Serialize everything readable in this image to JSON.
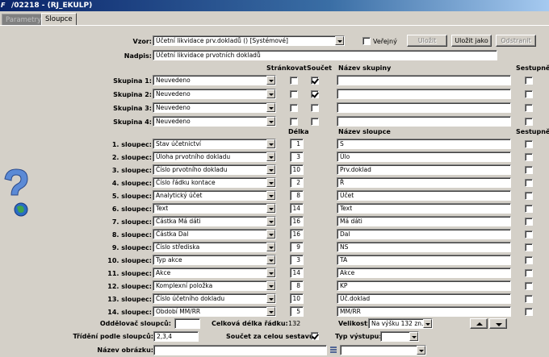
{
  "window": {
    "title": "/02218 - (RJ_EKULP)"
  },
  "tabs": [
    {
      "label": "Parametry"
    },
    {
      "label": "Sloupce"
    }
  ],
  "vzor": {
    "label": "Vzor:",
    "value": "Účetní likvidace prv.dokladů  ()  [Systémové]"
  },
  "verejny": {
    "label": "Veřejný",
    "checked": false
  },
  "buttons": {
    "ulozit": "Uložit",
    "ulozit_jako": "Uložit jako",
    "odstranit": "Odstranit"
  },
  "nadpis": {
    "label": "Nadpis:",
    "value": "Účetní likvidace prvotních dokladů"
  },
  "group_headers": {
    "strankovat": "Stránkovat",
    "soucet": "Součet",
    "nazev_skupiny": "Název skupiny",
    "sestupne": "Sestupně"
  },
  "groups": [
    {
      "label": "Skupina 1:",
      "value": "Neuvedeno",
      "strankovat": false,
      "soucet": true,
      "nazev": "",
      "sestupne": false
    },
    {
      "label": "Skupina 2:",
      "value": "Neuvedeno",
      "strankovat": false,
      "soucet": true,
      "nazev": "",
      "sestupne": false
    },
    {
      "label": "Skupina 3:",
      "value": "Neuvedeno",
      "strankovat": false,
      "soucet": false,
      "nazev": "",
      "sestupne": false
    },
    {
      "label": "Skupina 4:",
      "value": "Neuvedeno",
      "strankovat": false,
      "soucet": false,
      "nazev": "",
      "sestupne": false
    }
  ],
  "column_headers": {
    "delka": "Délka",
    "nazev_sloupce": "Název sloupce",
    "sestupne": "Sestupně"
  },
  "columns": [
    {
      "label": "1. sloupec:",
      "value": "Stav účetnictví",
      "delka": "1",
      "nazev": "S",
      "sestupne": false
    },
    {
      "label": "2. sloupec:",
      "value": "Úloha prvotního dokladu",
      "delka": "3",
      "nazev": "Úlo",
      "sestupne": false
    },
    {
      "label": "3. sloupec:",
      "value": "Číslo prvotního dokladu",
      "delka": "10",
      "nazev": "Prv.doklad",
      "sestupne": false
    },
    {
      "label": "4. sloupec:",
      "value": "Číslo řádku kontace",
      "delka": "2",
      "nazev": "Ř",
      "sestupne": false
    },
    {
      "label": "5. sloupec:",
      "value": "Analytický účet",
      "delka": "8",
      "nazev": "Účet",
      "sestupne": false
    },
    {
      "label": "6. sloupec:",
      "value": "Text",
      "delka": "14",
      "nazev": "Text",
      "sestupne": false
    },
    {
      "label": "7. sloupec:",
      "value": "Částka Má dáti",
      "delka": "16",
      "nazev": "Má dáti",
      "sestupne": false
    },
    {
      "label": "8. sloupec:",
      "value": "Částka Dal",
      "delka": "16",
      "nazev": "Dal",
      "sestupne": false
    },
    {
      "label": "9. sloupec:",
      "value": "Číslo střediska",
      "delka": "9",
      "nazev": "NS",
      "sestupne": false
    },
    {
      "label": "10. sloupec:",
      "value": "Typ akce",
      "delka": "3",
      "nazev": "TA",
      "sestupne": false
    },
    {
      "label": "11. sloupec:",
      "value": "Akce",
      "delka": "14",
      "nazev": "Akce",
      "sestupne": false
    },
    {
      "label": "12. sloupec:",
      "value": "Komplexní položka",
      "delka": "8",
      "nazev": "KP",
      "sestupne": false
    },
    {
      "label": "13. sloupec:",
      "value": "Číslo účetního dokladu",
      "delka": "10",
      "nazev": "Úč.doklad",
      "sestupne": false
    },
    {
      "label": "14. sloupec:",
      "value": "Období MM/RR",
      "delka": "5",
      "nazev": "MM/RR",
      "sestupne": false
    }
  ],
  "footer": {
    "oddelovac_label": "Oddělovač sloupců:",
    "oddelovac_value": "",
    "celkova_delka_label": "Celková délka řádku:",
    "celkova_delka_value": "132",
    "velikost_label": "Velikost:",
    "velikost_value": "Na výšku 132 zn.",
    "trideni_label": "Třídění podle sloupců:",
    "trideni_value": "2,3,4",
    "soucet_label": "Součet za celou sestavu:",
    "soucet_checked": true,
    "typ_vystupu_label": "Typ výstupu:",
    "typ_vystupu_value": "",
    "nazev_obrazku_label": "Název obrázku:",
    "nazev_obrazku_value": "",
    "obrazek_combo_value": ""
  },
  "colors": {
    "title_bar": "#0a246a",
    "window_bg": "#d4d0c8"
  },
  "icons": {
    "help": "question-mark-globe-icon"
  }
}
